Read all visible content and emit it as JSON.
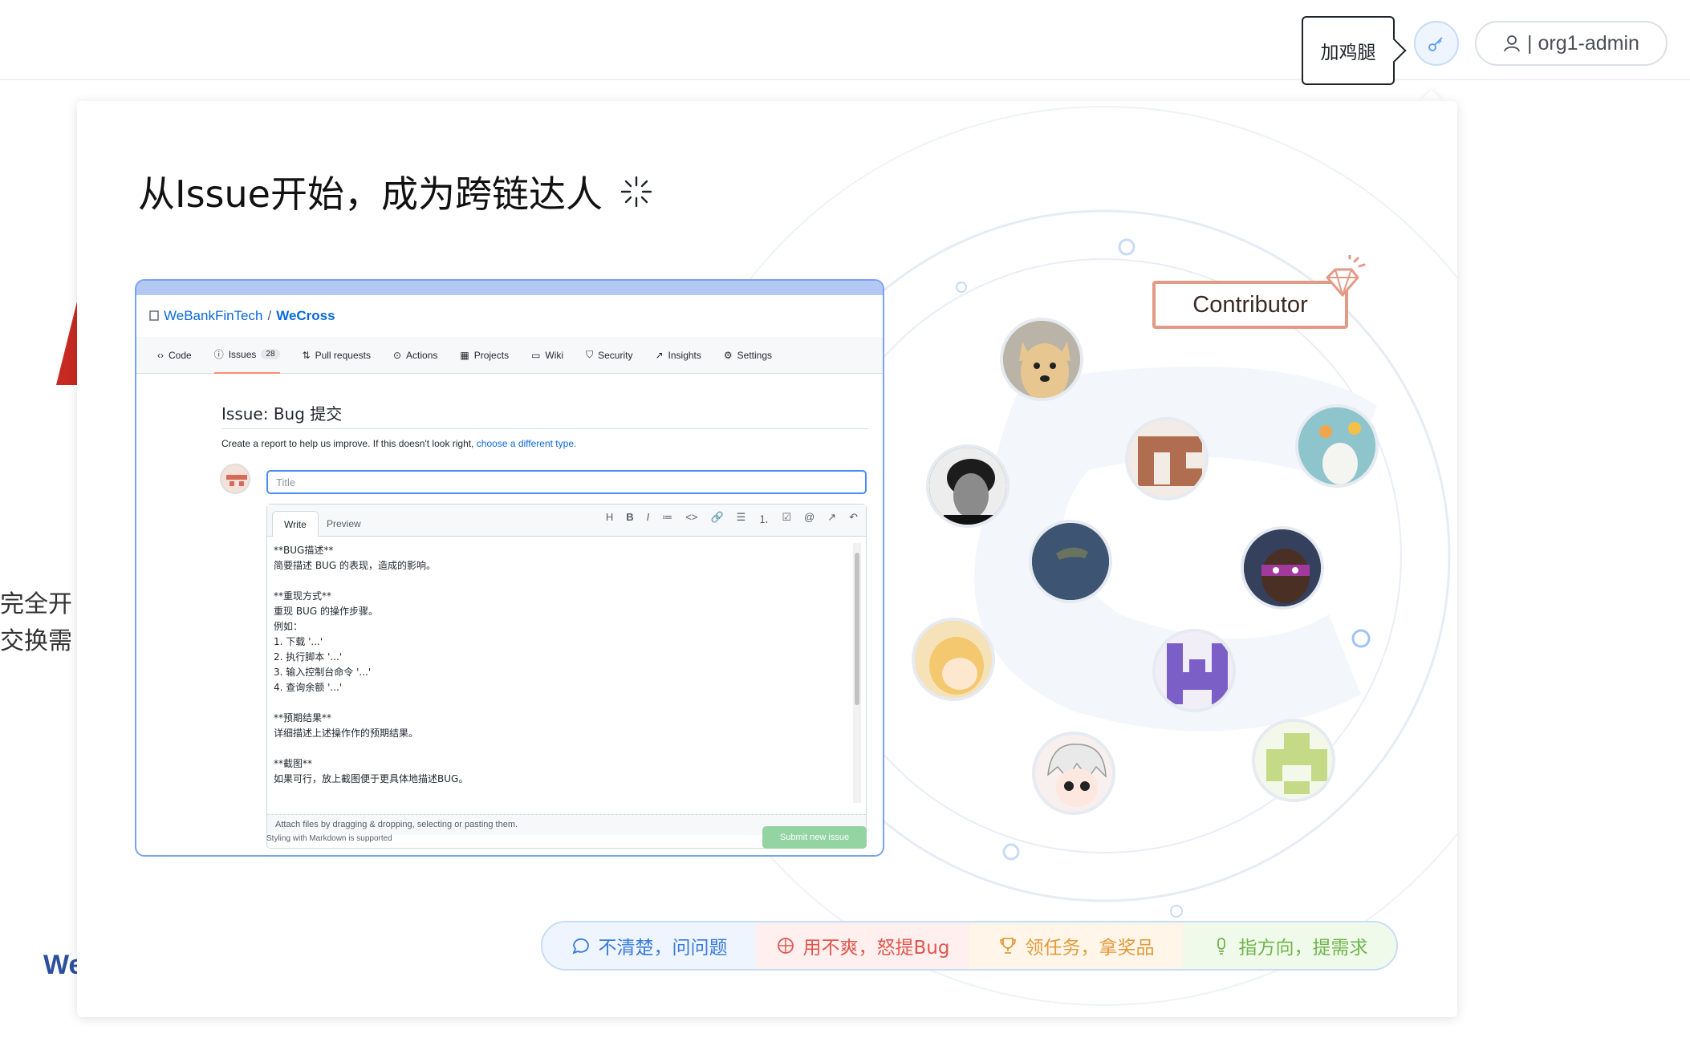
{
  "topbar": {
    "tooltip": "加鸡腿",
    "user_label": "| org1-admin"
  },
  "background": {
    "text_line1": "完全开",
    "text_line2": "交换需",
    "brand_fragment": "We"
  },
  "modal": {
    "title": "从Issue开始，成为跨链达人",
    "contributor_label": "Contributor"
  },
  "screenshot": {
    "org": "WeBankFinTech",
    "slash": "/",
    "repo": "WeCross",
    "nav": [
      {
        "label": "Code",
        "icon": "code-icon"
      },
      {
        "label": "Issues",
        "icon": "issue-icon",
        "counter": "28",
        "active": true
      },
      {
        "label": "Pull requests",
        "icon": "pull-request-icon"
      },
      {
        "label": "Actions",
        "icon": "play-icon"
      },
      {
        "label": "Projects",
        "icon": "project-icon"
      },
      {
        "label": "Wiki",
        "icon": "book-icon"
      },
      {
        "label": "Security",
        "icon": "shield-icon"
      },
      {
        "label": "Insights",
        "icon": "graph-icon"
      },
      {
        "label": "Settings",
        "icon": "gear-icon"
      }
    ],
    "issue_title": "Issue: Bug 提交",
    "desc_prefix": "Create a report to help us improve. If this doesn't look right,",
    "desc_link": "choose a different type.",
    "title_placeholder": "Title",
    "tab_write": "Write",
    "tab_preview": "Preview",
    "tools": [
      "H",
      "B",
      "I",
      "≔",
      "<>",
      "🔗",
      "☰",
      "⒈",
      "☑",
      "@",
      "↗",
      "↶"
    ],
    "body_text": "**BUG描述**\n简要描述 BUG 的表现，造成的影响。\n\n**重现方式**\n重现 BUG 的操作步骤。\n例如：\n1. 下载 '...'\n2. 执行脚本 '...'\n3. 输入控制台命令 '...'\n4. 查询余额 '...'\n\n**预期结果**\n详细描述上述操作作的预期结果。\n\n**截图**\n如果可行，放上截图便于更具体地描述BUG。",
    "attach_text": "Attach files by dragging & dropping, selecting or pasting them.",
    "markdown_note": "Styling with Markdown is supported",
    "submit_label": "Submit new issue"
  },
  "pills": [
    {
      "label": "不清楚，问问题",
      "icon": "chat-bubble-icon",
      "color": "#3a7ad9"
    },
    {
      "label": "用不爽，怒提Bug",
      "icon": "bug-icon",
      "color": "#e0564c"
    },
    {
      "label": "领任务，拿奖品",
      "icon": "trophy-icon",
      "color": "#e09b3d"
    },
    {
      "label": "指方向，提需求",
      "icon": "lightbulb-icon",
      "color": "#6fb54b"
    }
  ],
  "colors": {
    "accent_blue": "#3a7ad9",
    "contributor_border": "#e29a87",
    "brand_red": "#c62a22"
  }
}
